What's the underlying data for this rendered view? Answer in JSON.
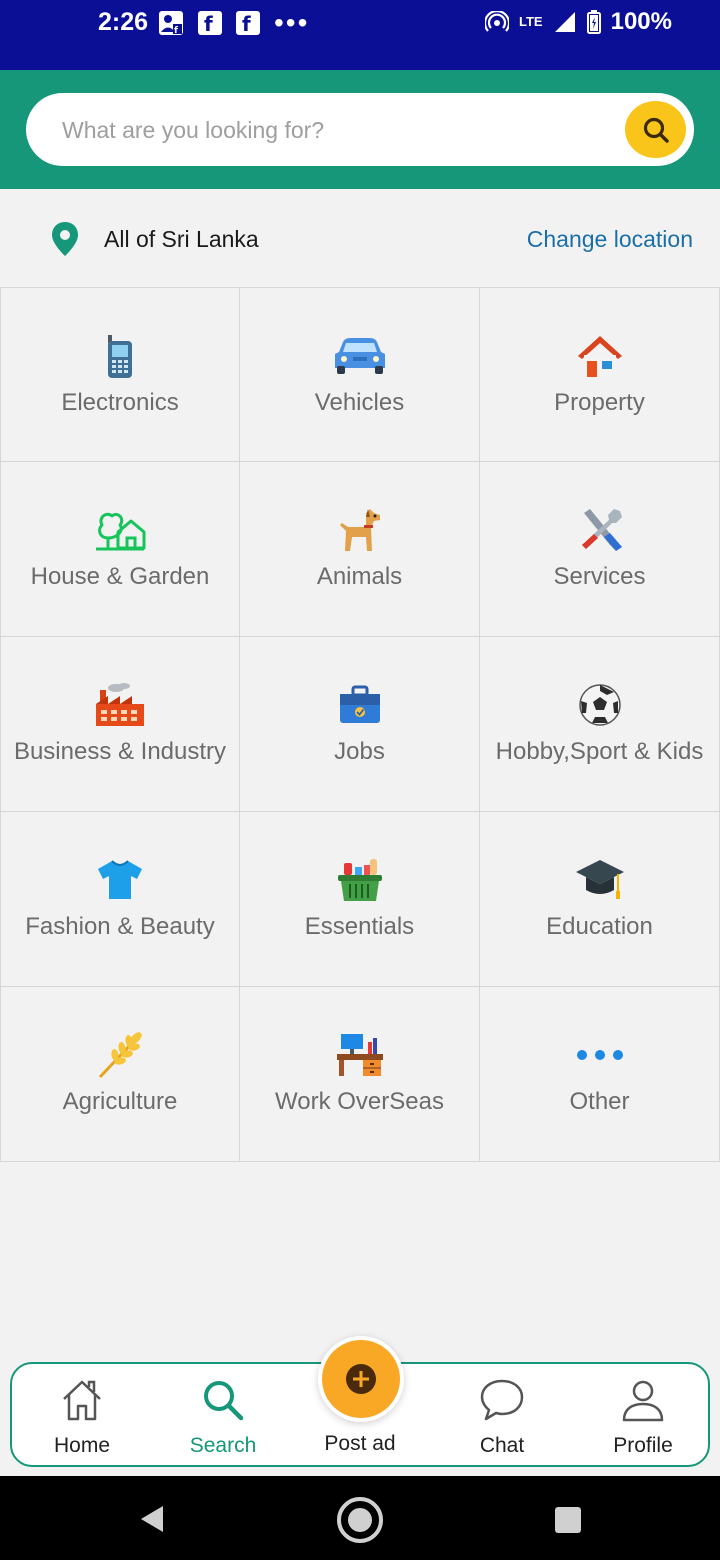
{
  "status_bar": {
    "time": "2:26",
    "network": "LTE",
    "battery": "100%"
  },
  "search": {
    "placeholder": "What are you looking for?"
  },
  "location": {
    "current": "All of Sri Lanka",
    "change_label": "Change location"
  },
  "categories": [
    {
      "label": "Electronics",
      "icon": "mobile-phone-icon"
    },
    {
      "label": "Vehicles",
      "icon": "car-icon"
    },
    {
      "label": "Property",
      "icon": "house-icon"
    },
    {
      "label": "House & Garden",
      "icon": "house-garden-icon"
    },
    {
      "label": "Animals",
      "icon": "dog-icon"
    },
    {
      "label": "Services",
      "icon": "tools-icon"
    },
    {
      "label": "Business & Industry",
      "icon": "factory-icon"
    },
    {
      "label": "Jobs",
      "icon": "briefcase-icon"
    },
    {
      "label": "Hobby,Sport & Kids",
      "icon": "soccer-ball-icon"
    },
    {
      "label": "Fashion & Beauty",
      "icon": "tshirt-icon"
    },
    {
      "label": "Essentials",
      "icon": "basket-icon"
    },
    {
      "label": "Education",
      "icon": "graduation-cap-icon"
    },
    {
      "label": "Agriculture",
      "icon": "wheat-icon"
    },
    {
      "label": "Work OverSeas",
      "icon": "desk-icon"
    },
    {
      "label": "Other",
      "icon": "dots-icon"
    }
  ],
  "bottom_nav": {
    "home": "Home",
    "search": "Search",
    "post": "Post ad",
    "chat": "Chat",
    "profile": "Profile"
  },
  "colors": {
    "brand": "#16977a",
    "accent": "#f9c51a",
    "status_bar": "#0a0f96",
    "link": "#1b6fa8"
  }
}
